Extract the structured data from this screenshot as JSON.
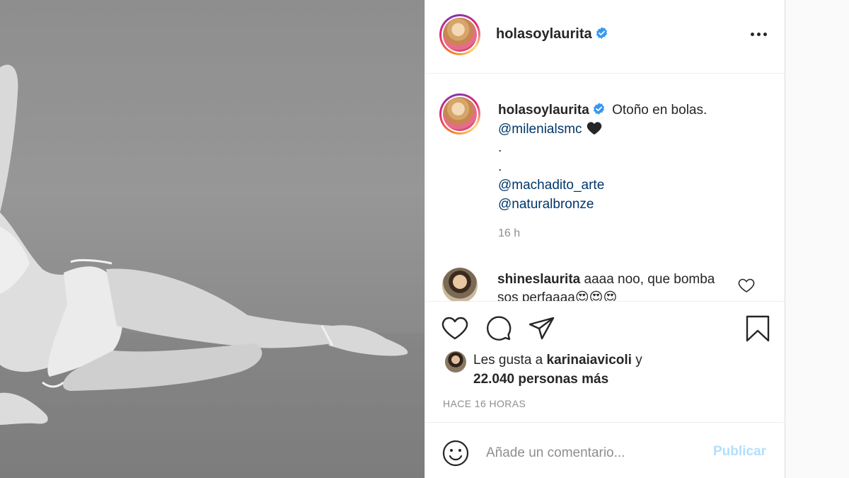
{
  "post": {
    "username": "holasoylaurita",
    "caption_text": "Otoño en bolas.",
    "caption_mention_1": "@milenialsmc",
    "caption_dot_1": ".",
    "caption_dot_2": ".",
    "caption_mention_2": "@machadito_arte",
    "caption_mention_3": "@naturalbronze",
    "caption_time": "16 h"
  },
  "comment": {
    "username": "shineslaurita",
    "text": "aaaa noo, que bomba sos perfaaaa😍😍😍"
  },
  "likes": {
    "prefix": "Les gusta a ",
    "user": "karinaiavicoli",
    "middle": " y",
    "count_text": "22.040 personas más"
  },
  "time_ago": "HACE 16 HORAS",
  "add_comment": {
    "placeholder": "Añade un comentario...",
    "publish_label": "Publicar"
  },
  "icons": {
    "verified": "verified-badge-icon",
    "more": "more-options-icon",
    "like": "heart-icon",
    "comment": "comment-icon",
    "share": "share-icon",
    "save": "bookmark-icon",
    "emoji": "emoji-icon"
  },
  "colors": {
    "verified_blue": "#3897f0",
    "link": "#00376b",
    "publish_disabled": "#b2dffc",
    "muted": "#8e8e8e"
  }
}
